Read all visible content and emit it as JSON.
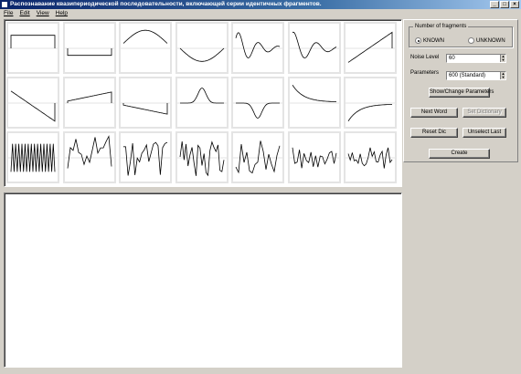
{
  "window": {
    "title": "Распознавание квазипериодической последовательности, включающей серии идентичных фрагментов.",
    "controls": [
      "_",
      "□",
      "×"
    ]
  },
  "menu": [
    "File",
    "Edit",
    "View",
    "Help"
  ],
  "fragments": {
    "group_label": "Number of fragments",
    "options": [
      "KNOWN",
      "UNKNOWN"
    ],
    "selected": "KNOWN"
  },
  "noise_level": {
    "label": "Noise Level",
    "value": "60"
  },
  "parameters": {
    "label": "Parameters",
    "value": "600 (Standard)"
  },
  "buttons": {
    "show_change": "Show/Change Parameters",
    "next_word": "Next Word",
    "set_dictionary": "Set Dictionary",
    "reset_dic": "Reset Dic",
    "unselect_last": "Unselect Last",
    "create": "Create"
  },
  "waveforms": [
    "flat-high",
    "flat-low",
    "arch-up",
    "arch-down",
    "damped-osc",
    "damped-osc-2",
    "ramp-up",
    "ramp-down",
    "ramp-up-offset",
    "ramp-down-offset",
    "peak",
    "dip",
    "decay-high",
    "decay-low",
    "sawtooth",
    "noise-1",
    "noise-2",
    "noise-3",
    "noise-4",
    "noise-5",
    "noise-6"
  ]
}
